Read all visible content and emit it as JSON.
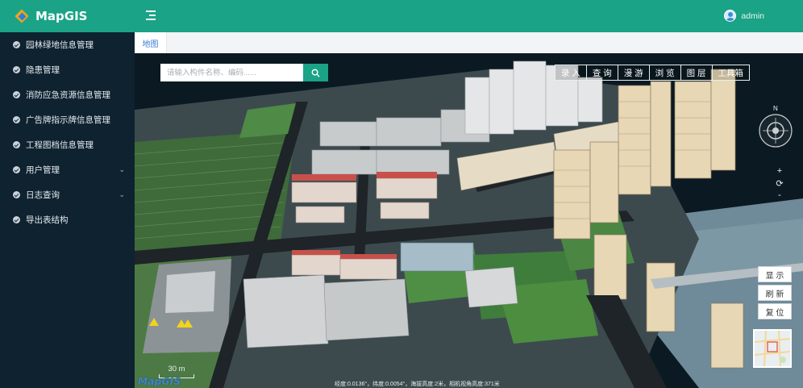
{
  "app": {
    "logo_text": "MapGIS"
  },
  "sidebar": {
    "items": [
      {
        "label": "园林绿地信息管理",
        "expandable": false
      },
      {
        "label": "隐患管理",
        "expandable": false
      },
      {
        "label": "消防应急资源信息管理",
        "expandable": false
      },
      {
        "label": "广告牌指示牌信息管理",
        "expandable": false
      },
      {
        "label": "工程图档信息管理",
        "expandable": false
      },
      {
        "label": "用户管理",
        "expandable": true
      },
      {
        "label": "日志查询",
        "expandable": true
      },
      {
        "label": "导出表结构",
        "expandable": false
      }
    ]
  },
  "header": {
    "user_name": "admin"
  },
  "tabs": [
    {
      "label": "地图"
    }
  ],
  "map": {
    "search": {
      "placeholder": "请输入构件名称、编码......"
    },
    "toolbar": [
      "录 入",
      "查 询",
      "漫 游",
      "浏 览",
      "图 层",
      "工具箱"
    ],
    "compass_label": "N",
    "zoom": {
      "in": "+",
      "reset": "⟳",
      "out": "-"
    },
    "side_buttons": [
      "显 示",
      "刷 新",
      "复 位"
    ],
    "scale_label": "30 m",
    "watermark": "MapGIS",
    "coords": "经度:0.0136°，纬度:0.0054°，海拔高度:2米，相机视角高度:371米"
  },
  "colors": {
    "accent": "#1aa386",
    "sidebar": "#0f2230"
  }
}
